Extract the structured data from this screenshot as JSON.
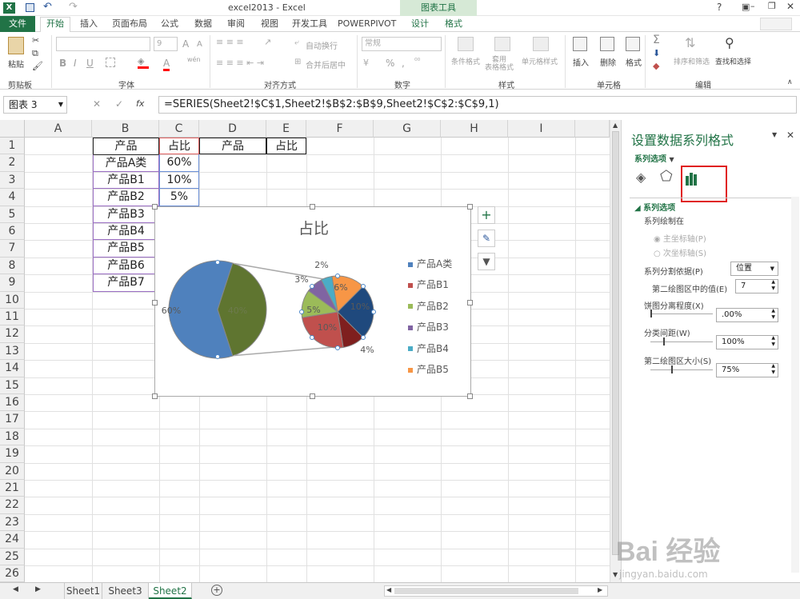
{
  "window": {
    "title": "excel2013 - Excel",
    "help": "?"
  },
  "chart_tools": {
    "label": "图表工具"
  },
  "tabs": {
    "file": "文件",
    "items": [
      "开始",
      "插入",
      "页面布局",
      "公式",
      "数据",
      "审阅",
      "视图",
      "开发工具",
      "POWERPIVOT"
    ],
    "design": "设计",
    "format": "格式"
  },
  "ribbon": {
    "clipboard": {
      "label": "剪贴板",
      "paste": "粘贴"
    },
    "font": {
      "label": "字体",
      "size": "9",
      "bold": "B",
      "italic": "I",
      "underline": "U",
      "grow": "A",
      "shrink": "A",
      "color_a": "A",
      "wen": "wén"
    },
    "alignment": {
      "label": "对齐方式",
      "wrap": "自动换行",
      "merge": "合并后居中"
    },
    "number": {
      "label": "数字",
      "format": "常规",
      "percent": "%",
      "comma": ","
    },
    "styles": {
      "label": "样式",
      "cond": "条件格式",
      "table": "套用\n表格格式",
      "cell": "单元格样式"
    },
    "cells": {
      "label": "单元格",
      "insert": "插入",
      "delete": "删除",
      "format": "格式"
    },
    "editing": {
      "label": "编辑",
      "sort": "排序和筛选",
      "find": "查找和选择"
    }
  },
  "formula_bar": {
    "name_box": "图表 3",
    "fx": "fx",
    "formula": "=SERIES(Sheet2!$C$1,Sheet2!$B$2:$B$9,Sheet2!$C$2:$C$9,1)"
  },
  "columns": [
    "A",
    "B",
    "C",
    "D",
    "E",
    "F",
    "G",
    "H",
    "I"
  ],
  "rows": [
    "1",
    "2",
    "3",
    "4",
    "5",
    "6",
    "7",
    "8",
    "9",
    "10",
    "11",
    "12",
    "13",
    "14",
    "15",
    "16",
    "17",
    "18",
    "19",
    "20",
    "21",
    "22",
    "23",
    "24",
    "25",
    "26"
  ],
  "cells": {
    "b1": "产品",
    "c1": "占比",
    "d1": "产品",
    "e1": "占比",
    "b": [
      "产品A类",
      "产品B1",
      "产品B2",
      "产品B3",
      "产品B4",
      "产品B5",
      "产品B6",
      "产品B7"
    ],
    "c": [
      "60%",
      "10%",
      "5%"
    ]
  },
  "chart": {
    "title": "占比",
    "main_labels": [
      "60%",
      "40%"
    ],
    "sub_labels": [
      "10%",
      "10%",
      "4%",
      "5%",
      "3%",
      "2%",
      "6%"
    ],
    "legend": [
      "产品A类",
      "产品B1",
      "产品B2",
      "产品B3",
      "产品B4",
      "产品B5"
    ]
  },
  "chart_data": {
    "type": "pie",
    "title": "占比",
    "subtype": "pie-of-pie",
    "categories": [
      "产品A类",
      "产品B1",
      "产品B2",
      "产品B3",
      "产品B4",
      "产品B5",
      "产品B6",
      "产品B7"
    ],
    "series": [
      {
        "name": "占比",
        "values": [
          60,
          10,
          5,
          3,
          2,
          6,
          4,
          10
        ]
      }
    ],
    "colors": [
      "#4f81bd",
      "#c0504d",
      "#9bbb59",
      "#8064a2",
      "#4bacc6",
      "#f79646",
      "#7f1f1e",
      "#1f497d"
    ],
    "main_split": [
      60,
      40
    ],
    "legend_position": "right"
  },
  "pane": {
    "title": "设置数据系列格式",
    "options_dropdown": "系列选项",
    "section": "系列选项",
    "plot_on": "系列绘制在",
    "primary": "主坐标轴(P)",
    "secondary": "次坐标轴(S)",
    "split_by": "系列分割依据(P)",
    "split_by_value": "位置",
    "second_values": "第二绘图区中的值(E)",
    "second_values_num": "7",
    "explosion": "饼图分离程度(X)",
    "explosion_val": ".00%",
    "gap": "分类间距(W)",
    "gap_val": "100%",
    "second_size": "第二绘图区大小(S)",
    "second_size_val": "75%"
  },
  "sheet_tabs": [
    "Sheet1",
    "Sheet3",
    "Sheet2"
  ],
  "watermark": {
    "text": "Bai 经验",
    "url": "jingyan.baidu.com"
  }
}
